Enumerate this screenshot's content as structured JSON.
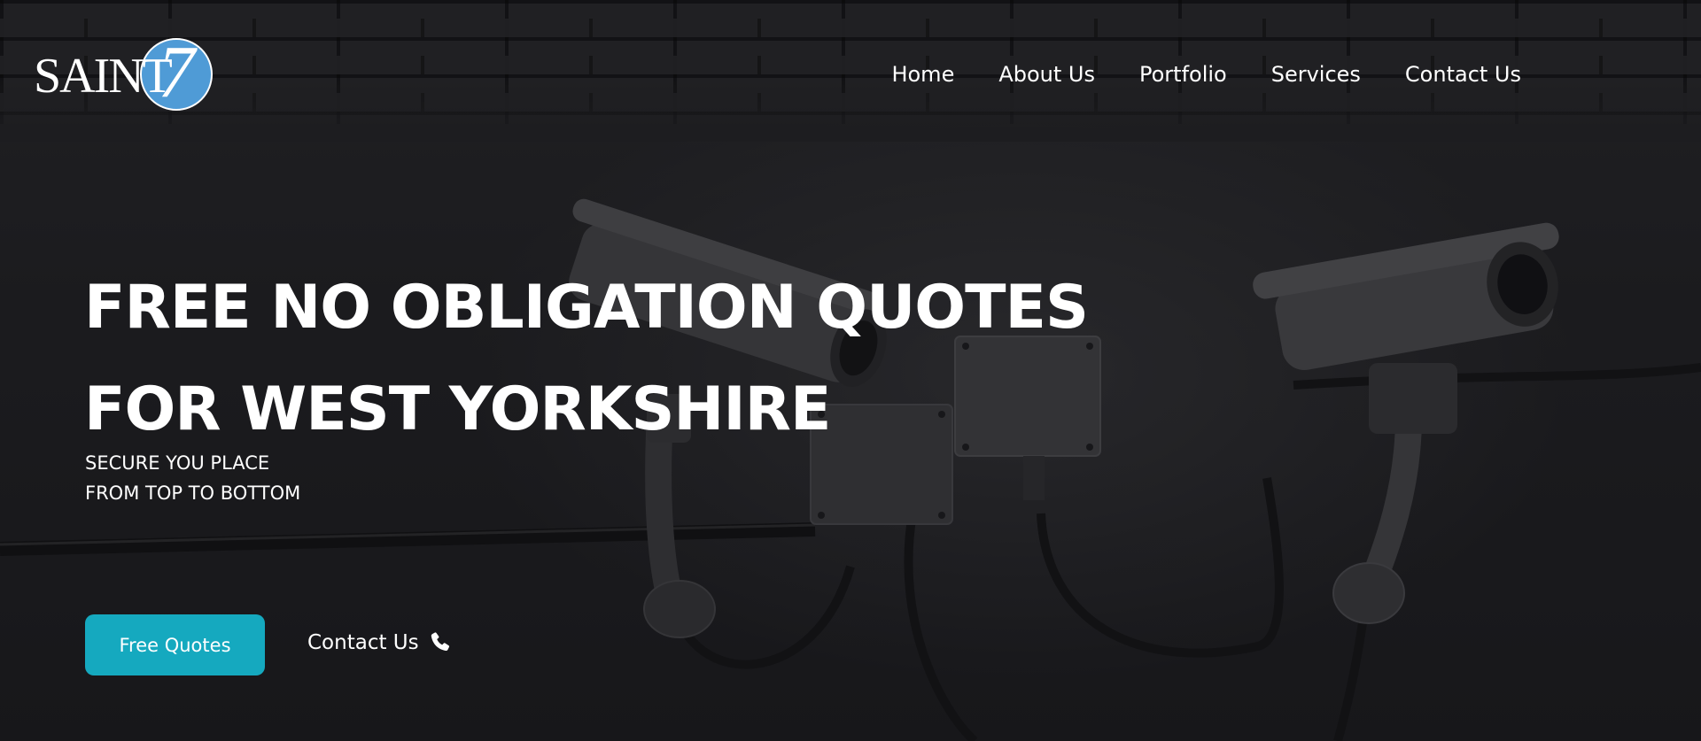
{
  "brand": {
    "logo_text": "SAINT",
    "logo_numeral": "7",
    "logo_color": "#4f9bd6"
  },
  "nav": {
    "items": [
      {
        "label": "Home"
      },
      {
        "label": "About Us"
      },
      {
        "label": "Portfolio"
      },
      {
        "label": "Services"
      },
      {
        "label": "Contact Us"
      }
    ]
  },
  "hero": {
    "headline_line1": "FREE NO OBLIGATION QUOTES",
    "headline_line2": "FOR WEST YORKSHIRE",
    "subline_line1": "SECURE YOU PLACE",
    "subline_line2": "FROM TOP TO BOTTOM",
    "background_image": "cctv-cameras-on-brick-wall",
    "primary_button_label": "Free Quotes",
    "secondary_link_label": "Contact Us",
    "secondary_link_icon": "phone-icon",
    "accent_color": "#15a9bf"
  }
}
